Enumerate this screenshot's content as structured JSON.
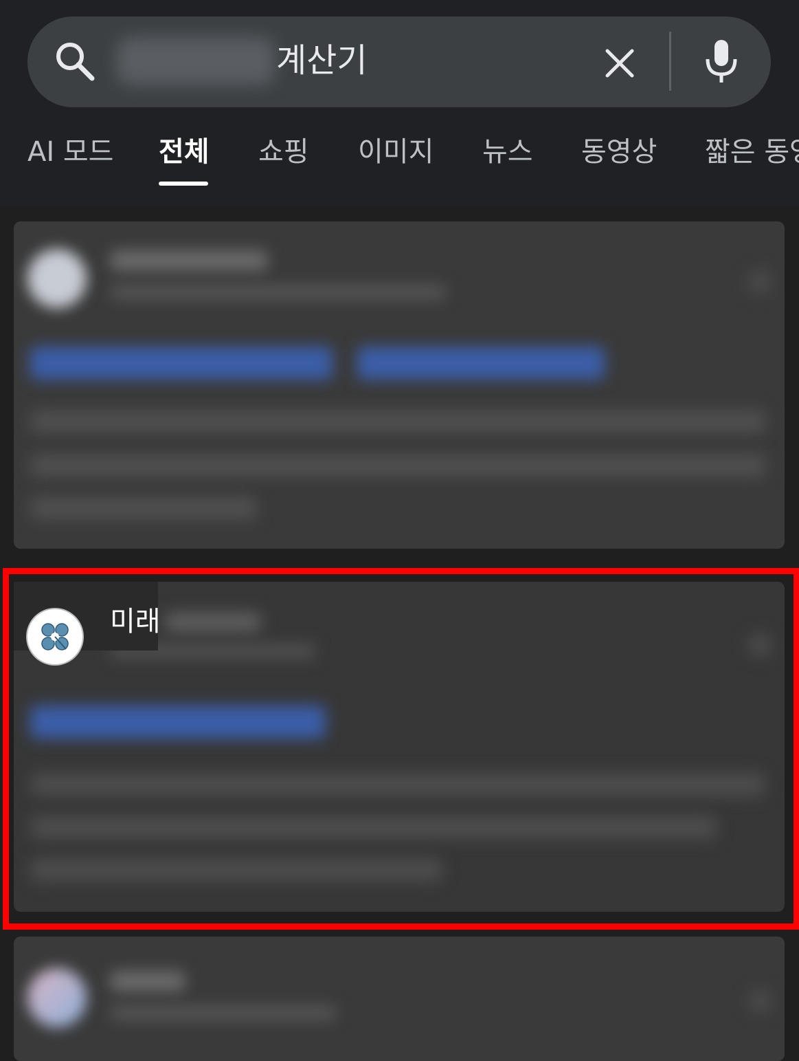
{
  "search": {
    "query": "계산기",
    "search_icon": "search-icon",
    "clear_icon": "close-icon",
    "voice_icon": "microphone-icon"
  },
  "tabs": [
    {
      "label": "AI 모드",
      "active": false
    },
    {
      "label": "전체",
      "active": true
    },
    {
      "label": "쇼핑",
      "active": false
    },
    {
      "label": "이미지",
      "active": false
    },
    {
      "label": "뉴스",
      "active": false
    },
    {
      "label": "동영상",
      "active": false
    },
    {
      "label": "짧은 동영",
      "active": false
    }
  ],
  "results": [
    {
      "site_name": "",
      "blurred": true
    },
    {
      "site_name": "미래",
      "blurred": true,
      "highlighted": true,
      "logo_icon": "clover-logo-icon"
    },
    {
      "site_name": "",
      "blurred": true
    }
  ],
  "colors": {
    "background": "#1f1f1f",
    "search_bg": "#3c4043",
    "card_bg": "#3a3a3a",
    "highlight": "#ff0000",
    "link_blur": "#3b5ea8"
  }
}
